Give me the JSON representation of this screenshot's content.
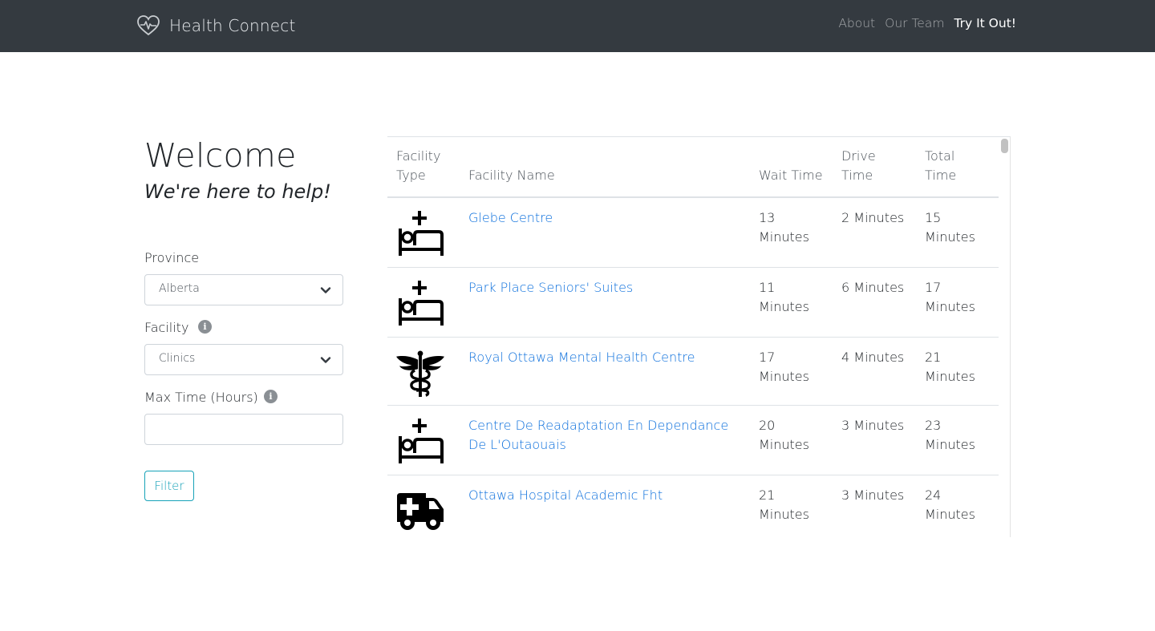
{
  "navbar": {
    "brand": "Health Connect",
    "links": [
      {
        "label": "About",
        "active": false
      },
      {
        "label": "Our Team",
        "active": false
      },
      {
        "label": "Try It Out!",
        "active": true
      }
    ]
  },
  "sidebar": {
    "title": "Welcome",
    "subtitle": "We're here to help!",
    "province": {
      "label": "Province",
      "value": "Alberta"
    },
    "facility": {
      "label": "Facility",
      "value": "Clinics",
      "info_icon": "info-icon"
    },
    "max_time": {
      "label": "Max Time (Hours)",
      "value": "",
      "info_icon": "info-icon"
    },
    "filter_button": "Filter"
  },
  "table": {
    "columns": {
      "type": "Facility Type",
      "name": "Facility Name",
      "wait": "Wait Time",
      "drive": "Drive Time",
      "total": "Total Time"
    },
    "rows": [
      {
        "type_icon": "hospital-bed-icon",
        "name": "Glebe Centre",
        "wait": "13 Minutes",
        "drive": "2 Minutes",
        "total": "15 Minutes"
      },
      {
        "type_icon": "hospital-bed-icon",
        "name": "Park Place Seniors' Suites",
        "wait": "11 Minutes",
        "drive": "6 Minutes",
        "total": "17 Minutes"
      },
      {
        "type_icon": "caduceus-icon",
        "name": "Royal Ottawa Mental Health Centre",
        "wait": "17 Minutes",
        "drive": "4 Minutes",
        "total": "21 Minutes"
      },
      {
        "type_icon": "hospital-bed-icon",
        "name": "Centre De Readaptation En Dependance De L'Outaouais",
        "wait": "20 Minutes",
        "drive": "3 Minutes",
        "total": "23 Minutes"
      },
      {
        "type_icon": "ambulance-icon",
        "name": "Ottawa Hospital Academic Fht",
        "wait": "21 Minutes",
        "drive": "3 Minutes",
        "total": "24 Minutes"
      }
    ]
  },
  "colors": {
    "navbar_bg": "#343a40",
    "link": "#0a6edc",
    "filter_accent": "#17a2b8"
  }
}
